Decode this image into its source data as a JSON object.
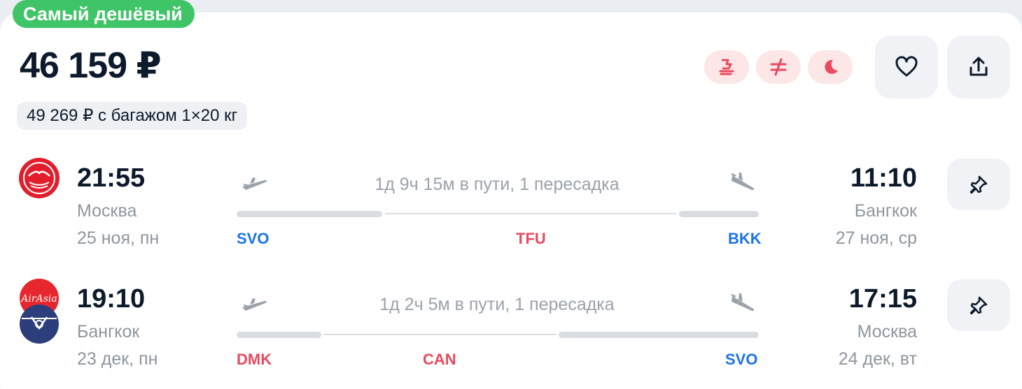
{
  "badge": "Самый дешёвый",
  "price": "46 159 ₽",
  "baggage": "49 269 ₽ с багажом 1×20 кг",
  "features": [
    {
      "icon": "seat-icon"
    },
    {
      "icon": "not-equal-icon"
    },
    {
      "icon": "moon-icon"
    }
  ],
  "actions": {
    "favorite_icon": "heart-icon",
    "share_icon": "share-icon"
  },
  "colors": {
    "badge": "#3fc467",
    "feature_bg": "#fde6e6",
    "feature_icon": "#e84a5f",
    "airport_blue": "#1a73e8",
    "airport_red": "#e84a5f"
  },
  "legs": [
    {
      "airline_icon": "aeroflot-logo",
      "depart_time": "21:55",
      "depart_city": "Москва",
      "depart_date": "25 ноя, пн",
      "duration": "1д 9ч 15м в пути, 1 пересадка",
      "arrive_time": "11:10",
      "arrive_city": "Бангкок",
      "arrive_date": "27 ноя, ср",
      "origin_code": "SVO",
      "transfer_code": "TFU",
      "dest_code": "BKK"
    },
    {
      "airline_icon": "airasia-logo",
      "depart_time": "19:10",
      "depart_city": "Бангкок",
      "depart_date": "23 дек, пн",
      "duration": "1д 2ч 5м в пути, 1 пересадка",
      "arrive_time": "17:15",
      "arrive_city": "Москва",
      "arrive_date": "24 дек, вт",
      "origin_code": "DMK",
      "transfer_code": "CAN",
      "dest_code": "SVO"
    }
  ]
}
